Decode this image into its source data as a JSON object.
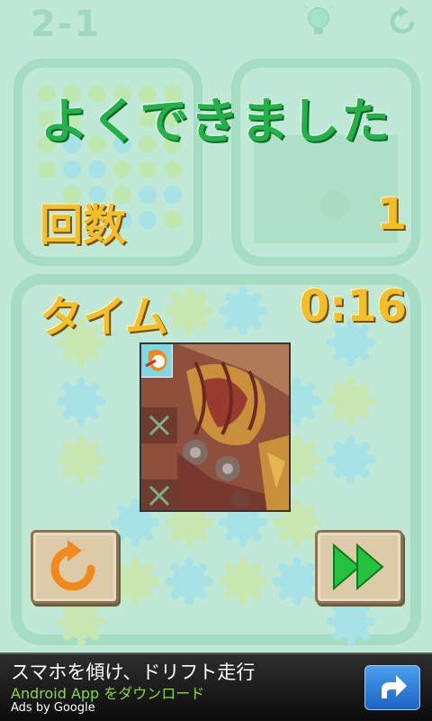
{
  "header": {
    "level": "2-1",
    "hint_icon": "lightbulb-icon",
    "reset_icon": "restart-icon"
  },
  "result": {
    "title": "よくできました",
    "moves_label": "回数",
    "moves_value": "1",
    "time_label": "タイム",
    "time_value": "0:16"
  },
  "buttons": {
    "retry_icon": "retry-icon",
    "next_icon": "fast-forward-icon"
  },
  "ad": {
    "title": "スマホを傾け、ドリフト走行",
    "subtitle": "Android App をダウンロード",
    "by": "Ads by Google",
    "action_icon": "share-arrow-icon"
  },
  "colors": {
    "title_green": "#24b14a",
    "stat_gold": "#f2bf2a",
    "retry_orange": "#f08a1c",
    "next_green": "#26c13d"
  }
}
